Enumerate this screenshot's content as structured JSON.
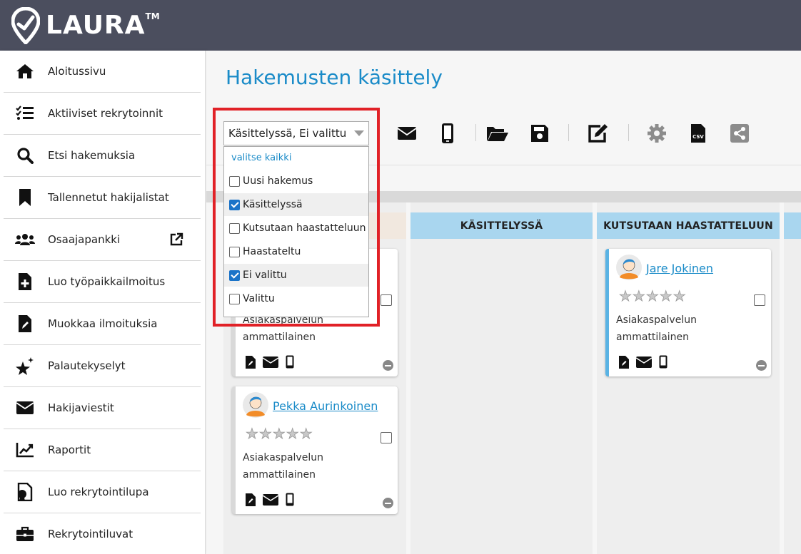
{
  "app": {
    "logo_text": "LAURA",
    "logo_tm": "TM"
  },
  "sidebar": {
    "items": [
      {
        "label": "Aloitussivu",
        "icon": "home-icon"
      },
      {
        "label": "Aktiiviset rekrytoinnit",
        "icon": "checklist-icon"
      },
      {
        "label": "Etsi hakemuksia",
        "icon": "search-icon"
      },
      {
        "label": "Tallennetut hakijalistat",
        "icon": "bookmark-icon"
      },
      {
        "label": "Osaajapankki",
        "icon": "users-icon"
      },
      {
        "label": "Luo työpaikkailmoitus",
        "icon": "file-plus-icon"
      },
      {
        "label": "Muokkaa ilmoituksia",
        "icon": "file-edit-icon"
      },
      {
        "label": "Palautekyselyt",
        "icon": "sparkle-star-icon"
      },
      {
        "label": "Hakijaviestit",
        "icon": "envelope-icon"
      },
      {
        "label": "Raportit",
        "icon": "chart-line-icon"
      },
      {
        "label": "Luo rekrytointilupa",
        "icon": "file-certificate-icon"
      },
      {
        "label": "Rekrytointiluvat",
        "icon": "briefcase-icon"
      }
    ]
  },
  "main": {
    "title": "Hakemusten käsittely"
  },
  "toolbar": {
    "icons": [
      "envelope-icon",
      "mobile-icon",
      "folder-open-icon",
      "save-icon",
      "edit-icon",
      "gear-icon",
      "csv-icon",
      "share-icon"
    ]
  },
  "filter": {
    "selected_text": "Käsittelyssä, Ei valittu",
    "select_all": "valitse kaikki",
    "options": [
      {
        "label": "Uusi hakemus",
        "checked": false
      },
      {
        "label": "Käsittelyssä",
        "checked": true
      },
      {
        "label": "Kutsutaan haastatteluun",
        "checked": false
      },
      {
        "label": "Haastateltu",
        "checked": false
      },
      {
        "label": "Ei valittu",
        "checked": true
      },
      {
        "label": "Valittu",
        "checked": false
      }
    ]
  },
  "columns": [
    {
      "title": ""
    },
    {
      "title": "KÄSITTELYSSÄ"
    },
    {
      "title": "KUTSUTAAN HAASTATTELUUN"
    }
  ],
  "cards": [
    {
      "name": "",
      "rating": 0,
      "job_line1": "Asiakaspalvelun",
      "job_line2": "ammattilainen"
    },
    {
      "name": "Pekka Aurinkoinen",
      "rating": 0,
      "job_line1": "Asiakaspalvelun",
      "job_line2": "ammattilainen"
    },
    {
      "name": "Jare Jokinen",
      "rating": 0,
      "job_line1": "Asiakaspalvelun",
      "job_line2": "ammattilainen"
    }
  ],
  "colors": {
    "accent": "#1a8bc8",
    "topbar": "#4b4e5e",
    "column_header": "#a9d6ef",
    "highlight": "#e12127"
  }
}
